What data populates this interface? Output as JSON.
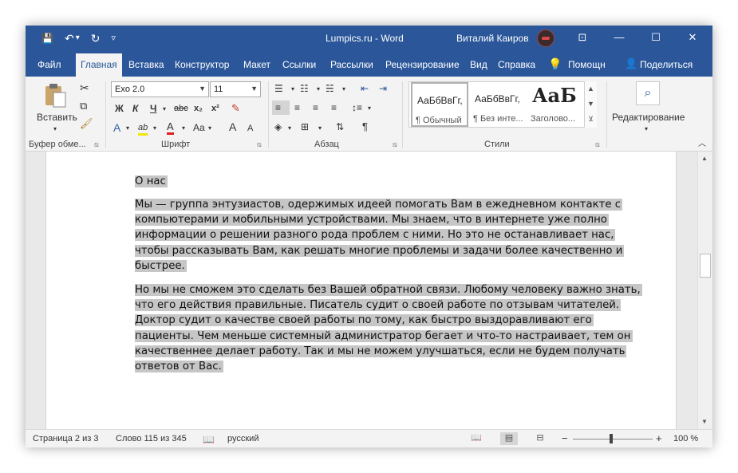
{
  "window": {
    "title": "Lumpics.ru  -  Word",
    "user": "Виталий Каиров",
    "controls": {
      "ribbon_display": "⊡",
      "minimize": "—",
      "maximize": "☐",
      "close": "✕"
    }
  },
  "qat": {
    "save": "💾",
    "undo": "↶",
    "undo_dropdown": "▾",
    "redo": "↻",
    "customize": "▿"
  },
  "tabs": [
    "Файл",
    "Главная",
    "Вставка",
    "Конструктор",
    "Макет",
    "Ссылки",
    "Рассылки",
    "Рецензирование",
    "Вид",
    "Справка"
  ],
  "active_tab": "Главная",
  "tell_me": "Помощн",
  "share": "Поделиться",
  "ribbon": {
    "clipboard": {
      "label": "Буфер обме...",
      "paste": "Вставить",
      "paste_arrow": "▾"
    },
    "font": {
      "label": "Шрифт",
      "font_name": "Exo 2.0",
      "font_size": "11",
      "bold": "Ж",
      "italic": "К",
      "underline": "Ч",
      "strike": "abc",
      "subscript": "x₂",
      "superscript": "x²",
      "text_effects": "A",
      "highlight": "ab",
      "font_color": "A",
      "change_case": "Aa",
      "grow": "A",
      "shrink": "A"
    },
    "paragraph": {
      "label": "Абзац",
      "pilcrow": "¶"
    },
    "styles": {
      "label": "Стили",
      "items": [
        {
          "sample": "АаБбВвГг,",
          "name": "¶ Обычный"
        },
        {
          "sample": "АаБбВвГг,",
          "name": "¶ Без инте..."
        },
        {
          "sample": "АаБ",
          "name": "Заголово..."
        }
      ]
    },
    "editing": {
      "label": "Редактирование",
      "arrow": "▾",
      "icon": "⌕"
    }
  },
  "document": {
    "heading": "О нас",
    "para1_lines": [
      "Мы — группа энтузиастов, одержимых идеей помогать Вам в ежедневном контакте с",
      "компьютерами и мобильными устройствами. Мы знаем, что в интернете уже полно",
      "информации о решении разного рода проблем с ними. Но это не останавливает нас,",
      "чтобы рассказывать Вам, как решать многие проблемы и задачи более качественно и",
      "быстрее."
    ],
    "para2_lines": [
      "Но мы не сможем это сделать без Вашей обратной связи. Любому человеку важно знать,",
      "что его действия правильные. Писатель судит о своей работе по отзывам читателей.",
      "Доктор судит о качестве своей работы по тому, как быстро выздоравливают его",
      "пациенты. Чем меньше системный администратор бегает и что-то настраивает, тем он",
      "качественнее делает работу. Так и мы не можем улучшаться, если не будем получать",
      "ответов от Вас."
    ]
  },
  "status": {
    "page": "Страница 2 из 3",
    "words": "Слово 115 из 345",
    "language": "русский",
    "zoom": "100 %",
    "zoom_minus": "−",
    "zoom_plus": "+",
    "zoom_fraction": 0.5
  },
  "colors": {
    "title_bar": "#2b579a",
    "selection": "#c6c6c6",
    "ribbon_bg": "#f3f3f3"
  }
}
